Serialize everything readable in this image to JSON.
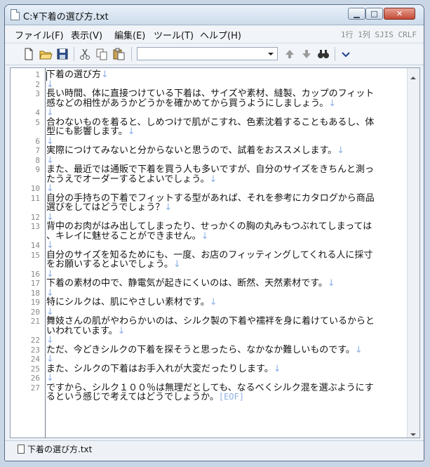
{
  "window": {
    "title": "C:¥下着の選び方.txt"
  },
  "menu": [
    "ファイル(F)",
    "表示(V)",
    "編集(E)",
    "ツール(T)",
    "ヘルプ(H)"
  ],
  "status_info": "1行 1列  SJIS  CRLF",
  "toolbar": {
    "icons": [
      "new-file-icon",
      "open-folder-icon",
      "save-icon",
      "cut-icon",
      "copy-icon",
      "paste-icon",
      "search-combo",
      "find-prev-icon",
      "find-next-icon",
      "find-icon",
      "dropdown-icon"
    ],
    "search_value": ""
  },
  "lines": [
    {
      "n": "1",
      "t": "下着の選び方"
    },
    {
      "n": "2",
      "t": ""
    },
    {
      "n": "3",
      "t": "長い時間、体に直接つけている下着は、サイズや素材、縫製、カップのフィット"
    },
    {
      "n": "",
      "t": "感などの相性があうかどうかを確かめてから買うようにしましょう。"
    },
    {
      "n": "4",
      "t": ""
    },
    {
      "n": "5",
      "t": "合わないものを着ると、しめつけで肌がこすれ、色素沈着することもあるし、体"
    },
    {
      "n": "",
      "t": "型にも影響します。"
    },
    {
      "n": "6",
      "t": ""
    },
    {
      "n": "7",
      "t": "実際につけてみないと分からないと思うので、試着をおススメします。"
    },
    {
      "n": "8",
      "t": ""
    },
    {
      "n": "9",
      "t": "また、最近では通販で下着を買う人も多いですが、自分のサイズをきちんと測っ"
    },
    {
      "n": "",
      "t": "たうえでオーダーするとよいでしょう。"
    },
    {
      "n": "10",
      "t": ""
    },
    {
      "n": "11",
      "t": "自分の手持ちの下着でフィットする型があれば、それを参考にカタログから商品"
    },
    {
      "n": "",
      "t": "選びをしてはどうでしょう？"
    },
    {
      "n": "12",
      "t": ""
    },
    {
      "n": "13",
      "t": "背中のお肉がはみ出してしまったり、せっかくの胸の丸みもつぶれてしまっては"
    },
    {
      "n": "",
      "t": "、キレイに魅せることができません。"
    },
    {
      "n": "14",
      "t": ""
    },
    {
      "n": "15",
      "t": "自分のサイズを知るためにも、一度、お店のフィッティングしてくれる人に採寸"
    },
    {
      "n": "",
      "t": "をお願いするとよいでしょう。"
    },
    {
      "n": "16",
      "t": ""
    },
    {
      "n": "17",
      "t": "下着の素材の中で、静電気が起きにくいのは、断然、天然素材です。"
    },
    {
      "n": "18",
      "t": ""
    },
    {
      "n": "19",
      "t": "特にシルクは、肌にやさしい素材です。"
    },
    {
      "n": "20",
      "t": ""
    },
    {
      "n": "21",
      "t": "舞妓さんの肌がやわらかいのは、シルク製の下着や襦袢を身に着けているからと"
    },
    {
      "n": "",
      "t": "いわれています。"
    },
    {
      "n": "22",
      "t": ""
    },
    {
      "n": "23",
      "t": "ただ、今どきシルクの下着を探そうと思ったら、なかなか難しいものです。"
    },
    {
      "n": "24",
      "t": ""
    },
    {
      "n": "25",
      "t": "また、シルクの下着はお手入れが大変だったりします。"
    },
    {
      "n": "26",
      "t": ""
    },
    {
      "n": "27",
      "t": "ですから、シルク１００％は無理だとしても、なるべくシルク混を選ぶようにす"
    },
    {
      "n": "",
      "t": "るという感じで考えてはどうでしょうか。"
    }
  ],
  "line_end_marker": "↓",
  "eof_marker": "[EOF]",
  "status": {
    "filename": "下着の選び方.txt"
  },
  "colors": {
    "marker": "#8db0e6",
    "line_numbers": "#888888"
  }
}
